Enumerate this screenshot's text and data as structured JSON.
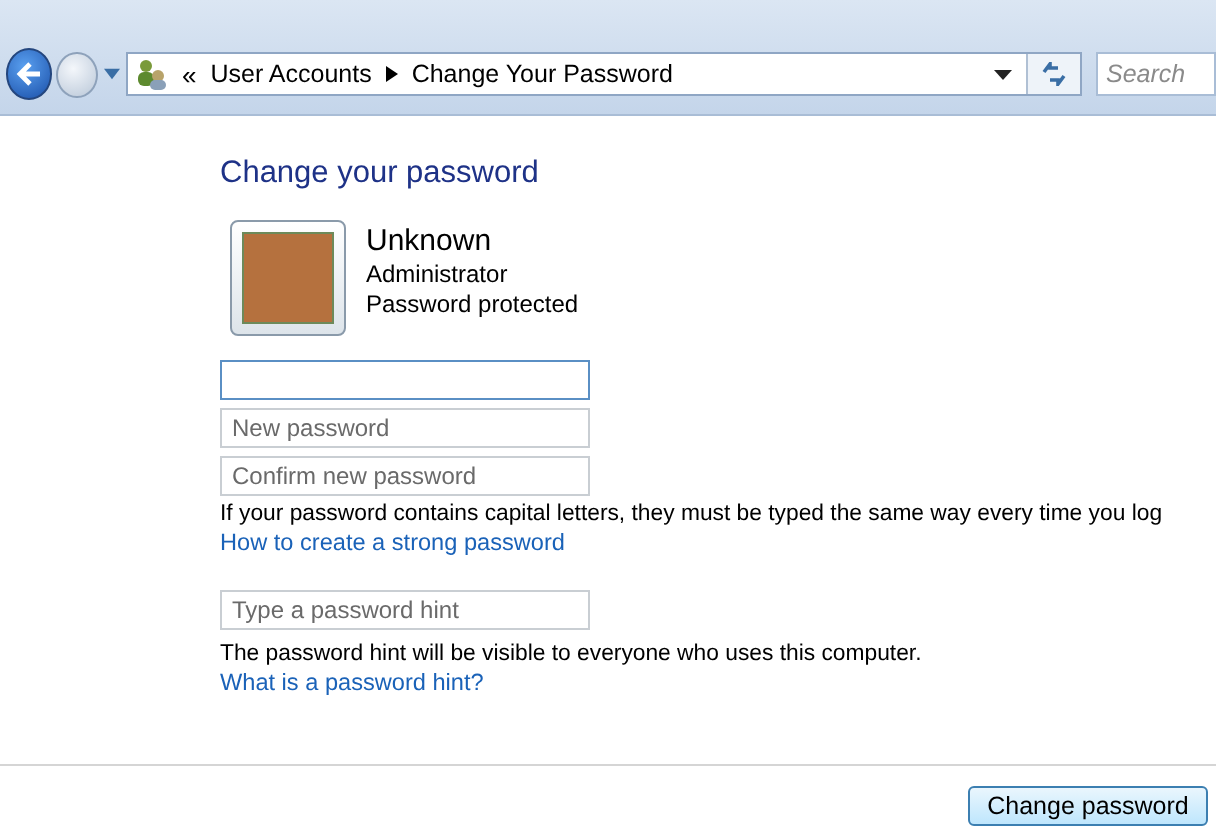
{
  "address_bar": {
    "chevron": "«",
    "crumbs": [
      "User Accounts",
      "Change Your Password"
    ]
  },
  "search": {
    "placeholder": "Search"
  },
  "heading": "Change your password",
  "account": {
    "name": "Unknown",
    "role": "Administrator",
    "status": "Password protected"
  },
  "password_fields": [
    {
      "focused": true
    },
    {
      "placeholder": "New password",
      "focused": false
    },
    {
      "placeholder": "Confirm new password",
      "focused": false
    }
  ],
  "note": "If your password contains capital letters, they must be typed the same way every time you log",
  "strong_link": "How to create a strong password",
  "hint_field": {
    "placeholder": "Type a password hint"
  },
  "hint_note": "The password hint will be visible to everyone who uses this computer.",
  "hint_link": "What is a password hint?",
  "submit": "Change password"
}
